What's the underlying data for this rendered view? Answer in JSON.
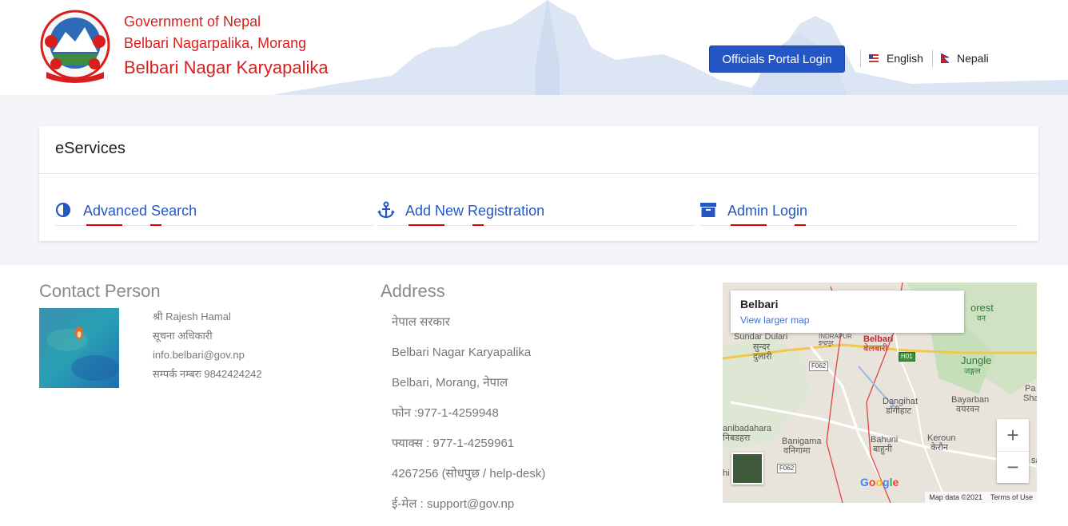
{
  "header": {
    "gov_line1": "Government of Nepal",
    "gov_line2": "Belbari Nagarpalika, Morang",
    "gov_line3": "Belbari Nagar Karyapalika",
    "portal_button": "Officials Portal Login",
    "languages": [
      {
        "label": "English",
        "flag": "us-flag-icon"
      },
      {
        "label": "Nepali",
        "flag": "nepal-flag-icon"
      }
    ]
  },
  "eservices": {
    "title": "eServices",
    "items": [
      {
        "label": "Advanced Search",
        "icon": "half-circle-icon"
      },
      {
        "label": "Add New Registration",
        "icon": "anchor-icon"
      },
      {
        "label": "Admin Login",
        "icon": "archive-box-icon"
      }
    ]
  },
  "contact": {
    "title": "Contact Person",
    "name": "श्री Rajesh Hamal",
    "role": "सूचना अधिकारी",
    "email": "info.belbari@gov.np",
    "phone": "सम्पर्क नम्बरः 9842424242"
  },
  "address": {
    "title": "Address",
    "lines": [
      "नेपाल सरकार",
      "Belbari Nagar Karyapalika",
      "Belbari, Morang, नेपाल",
      "फोन :977-1-4259948",
      "फ्याक्स : 977-1-4259961",
      "4267256 (सोधपुछ / help-desk)",
      "ई-मेल : support@gov.np"
    ]
  },
  "map": {
    "place_title": "Belbari",
    "larger_map_link": "View larger map",
    "labels": {
      "sundar": "Sundar Dulari",
      "sundar_np": "सुन्दर",
      "sundar_np2": "दुलारी",
      "indrapur": "INDRAPUR",
      "indrapur_np": "इन्द्रपुर",
      "belbari": "Belbari",
      "belbari_np": "बेलबारी",
      "forest": "orest",
      "forest_np": "वन",
      "jungle": "Jungle",
      "jungle_np": "जङ्गल",
      "dangihat": "Dangihat",
      "dangihat_np": "डाँगीहाट",
      "bayarban": "Bayarban",
      "bayarban_np": "वयरवन",
      "shanis": "Pa",
      "shanis2": "Shanis",
      "anibadahara": "anibadahara",
      "anibadahara_np": "निबडहरा",
      "banigama": "Banigama",
      "banigama_np": "वनिगामा",
      "bahuni": "Bahuni",
      "bahuni_np": "बाहुनी",
      "keroun": "Keroun",
      "keroun_np": "केरौन",
      "road_f062a": "F062",
      "road_f062b": "F062",
      "road_h01": "H01",
      "hi": "hi",
      "sa": "sa"
    },
    "google": "Google",
    "map_data": "Map data ©2021",
    "terms": "Terms of Use",
    "zoom_in": "+",
    "zoom_out": "−"
  }
}
